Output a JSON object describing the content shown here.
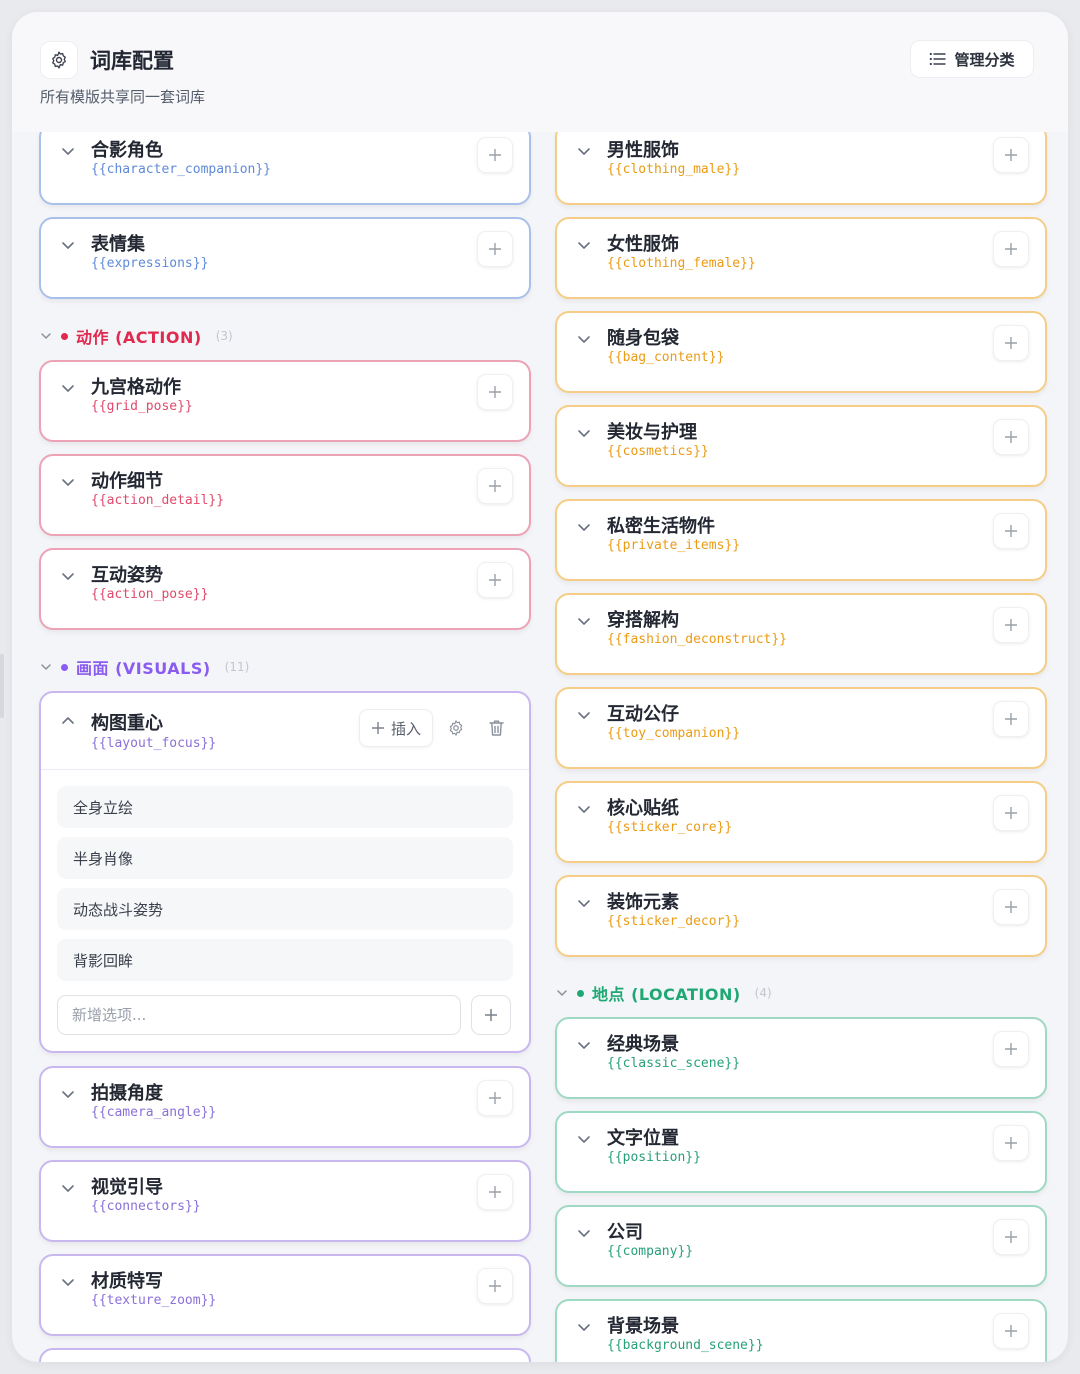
{
  "header": {
    "title": "词库配置",
    "subtitle": "所有模版共享同一套词库",
    "manage_label": "管理分类"
  },
  "left": {
    "top_cards": [
      {
        "name": "合影角色",
        "var": "{{character_companion}}"
      },
      {
        "name": "表情集",
        "var": "{{expressions}}"
      }
    ],
    "action": {
      "label": "动作 (ACTION)",
      "count": "(3)",
      "color": "#e0294f",
      "cards": [
        {
          "name": "九宫格动作",
          "var": "{{grid_pose}}"
        },
        {
          "name": "动作细节",
          "var": "{{action_detail}}"
        },
        {
          "name": "互动姿势",
          "var": "{{action_pose}}"
        }
      ]
    },
    "visuals": {
      "label": "画面 (VISUALS)",
      "count": "(11)",
      "color": "#8a5cf0",
      "expanded": {
        "name": "构图重心",
        "var": "{{layout_focus}}",
        "insert_label": "插入",
        "options": [
          "全身立绘",
          "半身肖像",
          "动态战斗姿势",
          "背影回眸"
        ],
        "new_placeholder": "新增选项..."
      },
      "cards": [
        {
          "name": "拍摄角度",
          "var": "{{camera_angle}}"
        },
        {
          "name": "视觉引导",
          "var": "{{connectors}}"
        },
        {
          "name": "材质特写",
          "var": "{{texture_zoom}}"
        }
      ]
    }
  },
  "right": {
    "clothing_cards": [
      {
        "name": "男性服饰",
        "var": "{{clothing_male}}"
      },
      {
        "name": "女性服饰",
        "var": "{{clothing_female}}"
      },
      {
        "name": "随身包袋",
        "var": "{{bag_content}}"
      },
      {
        "name": "美妆与护理",
        "var": "{{cosmetics}}"
      },
      {
        "name": "私密生活物件",
        "var": "{{private_items}}"
      },
      {
        "name": "穿搭解构",
        "var": "{{fashion_deconstruct}}"
      },
      {
        "name": "互动公仔",
        "var": "{{toy_companion}}"
      },
      {
        "name": "核心贴纸",
        "var": "{{sticker_core}}"
      },
      {
        "name": "装饰元素",
        "var": "{{sticker_decor}}"
      }
    ],
    "location": {
      "label": "地点 (LOCATION)",
      "count": "(4)",
      "color": "#1fa874",
      "cards": [
        {
          "name": "经典场景",
          "var": "{{classic_scene}}"
        },
        {
          "name": "文字位置",
          "var": "{{position}}"
        },
        {
          "name": "公司",
          "var": "{{company}}"
        },
        {
          "name": "背景场景",
          "var": "{{background_scene}}"
        }
      ]
    }
  }
}
